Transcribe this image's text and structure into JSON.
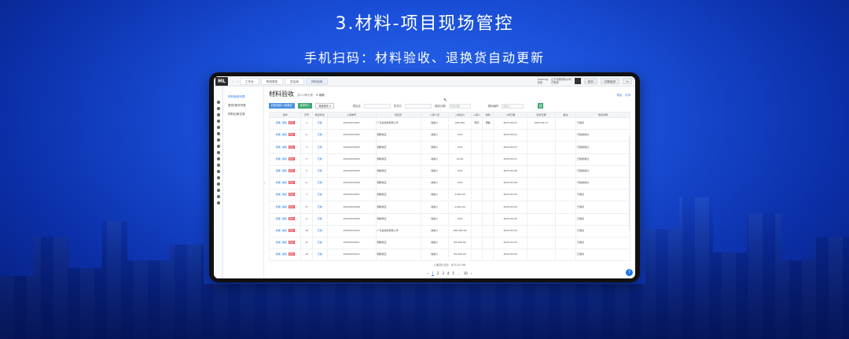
{
  "slide": {
    "title": "3.材料-项目现场管控",
    "subtitle": "手机扫码：材料验收、退换货自动更新"
  },
  "app": {
    "logo": "ML",
    "tabs": [
      "工作台",
      "物资类型",
      "供应商",
      "材料验收"
    ],
    "user_line1": "Liaoning",
    "user_line2": "在线",
    "org_line1": "辽宁省某材料公司",
    "org_line2": "已登录",
    "btn_home": "首页",
    "btn_switch": "切换组织"
  },
  "sidemenu": {
    "items": [
      "材料验收列表",
      "退货/换货列表",
      "材料出库记录"
    ]
  },
  "page": {
    "title": "材料验收",
    "subtitle": "共123条记录",
    "refresh": "刷新",
    "right_links": [
      "导出",
      "打印"
    ],
    "btn_scan": "扫码验收/入库登记",
    "btn_import": "批量导入",
    "btn_filter": "筛选条件",
    "label_project": "项目名",
    "label_supplier": "供货方",
    "label_date": "验收日期",
    "date_placeholder": "开始日期",
    "label_material": "物料编号",
    "material_placeholder": "请输入",
    "search": "搜"
  },
  "table": {
    "headers": [
      "操作",
      "序号",
      "收货状态",
      "入库单号",
      "供应商",
      "入库人员",
      "入库总价",
      "入库人",
      "物料",
      "入库日期",
      "收货日期",
      "备注",
      "收货说明"
    ],
    "ops": [
      "查看",
      "编辑",
      "删除"
    ],
    "rows": [
      {
        "n": "1",
        "status": "已收",
        "no": "20230415001",
        "supplier": "广东某建材有限公司",
        "person": "验收人",
        "total": "261,000",
        "who": "李四",
        "mat": "钢筋",
        "date": "2023-05-07",
        "rdate": "2023-05-17",
        "note": "",
        "desc": "已收货"
      },
      {
        "n": "2",
        "status": "已收",
        "no": "20230415002",
        "supplier": "钢筋供应",
        "person": "验收人",
        "total": "0.00",
        "who": "",
        "mat": "",
        "date": "2023-05-07",
        "rdate": "",
        "note": "",
        "desc": "已验收通过"
      },
      {
        "n": "3",
        "status": "已收",
        "no": "20230415003",
        "supplier": "钢筋供应",
        "person": "验收人",
        "total": "0.00",
        "who": "",
        "mat": "",
        "date": "2023-05-07",
        "rdate": "",
        "note": "",
        "desc": "已验收通过"
      },
      {
        "n": "4",
        "status": "已收",
        "no": "20230415004",
        "supplier": "钢筋供应",
        "person": "验收人",
        "total": "20.00",
        "who": "",
        "mat": "",
        "date": "2023-05-07",
        "rdate": "",
        "note": "",
        "desc": "已验收通过"
      },
      {
        "n": "5",
        "status": "已收",
        "no": "20230415005",
        "supplier": "钢筋供应",
        "person": "验收人",
        "total": "0.00",
        "who": "",
        "mat": "",
        "date": "2023-05-06",
        "rdate": "",
        "note": "",
        "desc": "已验收通过"
      },
      {
        "n": "6",
        "status": "已收",
        "no": "20230415006",
        "supplier": "钢筋供应",
        "person": "验收人",
        "total": "0.00",
        "who": "",
        "mat": "",
        "date": "2023-05-06",
        "rdate": "",
        "note": "",
        "desc": "已验收通过"
      },
      {
        "n": "7",
        "status": "已收",
        "no": "20230415007",
        "supplier": "钢筋供应",
        "person": "验收人",
        "total": "1,000.00",
        "who": "",
        "mat": "",
        "date": "2023-05-05",
        "rdate": "",
        "note": "",
        "desc": "已收货"
      },
      {
        "n": "8",
        "status": "已收",
        "no": "20230415008",
        "supplier": "钢筋供应",
        "person": "验收人",
        "total": "1,000.00",
        "who": "",
        "mat": "",
        "date": "2023-05-05",
        "rdate": "",
        "note": "",
        "desc": "已收货"
      },
      {
        "n": "9",
        "status": "已收",
        "no": "20230415009",
        "supplier": "钢筋供应",
        "person": "验收人",
        "total": "0.00",
        "who": "",
        "mat": "",
        "date": "2023-05-04",
        "rdate": "",
        "note": "",
        "desc": "已收货"
      },
      {
        "n": "10",
        "status": "已收",
        "no": "20230415010",
        "supplier": "广东某建材有限公司",
        "person": "验收人",
        "total": "186,400.00",
        "who": "",
        "mat": "",
        "date": "2023-05-04",
        "rdate": "",
        "note": "",
        "desc": "已收货"
      },
      {
        "n": "11",
        "status": "已收",
        "no": "20230415011",
        "supplier": "钢筋供应",
        "person": "验收人",
        "total": "82,000.00",
        "who": "",
        "mat": "",
        "date": "2023-05-03",
        "rdate": "",
        "note": "",
        "desc": "已收货"
      },
      {
        "n": "12",
        "status": "已收",
        "no": "20230415012",
        "supplier": "钢筋供应",
        "person": "验收人",
        "total": "82,000.00",
        "who": "",
        "mat": "",
        "date": "2023-05-03",
        "rdate": "",
        "note": "",
        "desc": "已收货"
      }
    ],
    "summary": "入库总价合计：872,411.96"
  },
  "pager": {
    "pages": [
      "1",
      "2",
      "3",
      "4",
      "5",
      "...",
      "10"
    ],
    "current": "1"
  }
}
